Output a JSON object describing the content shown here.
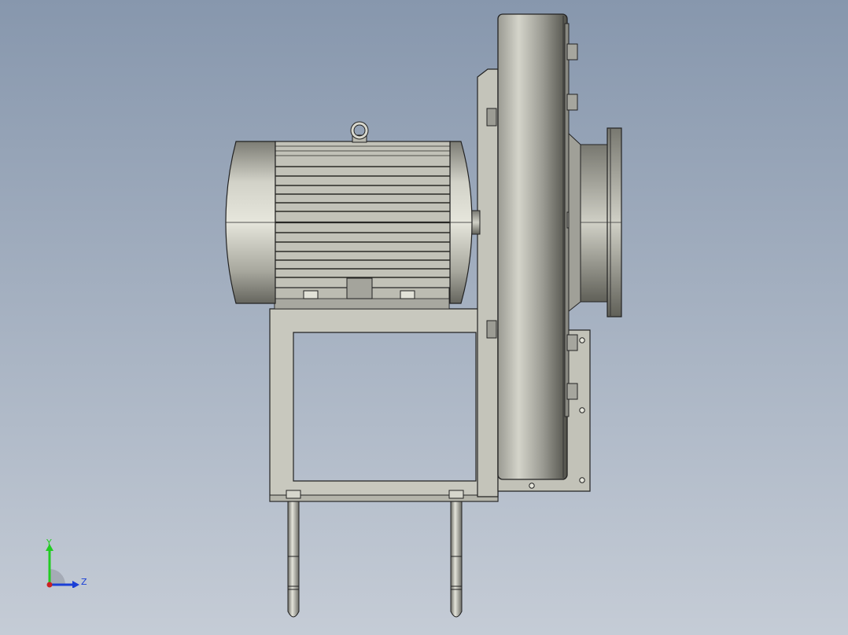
{
  "viewport": {
    "background_top": "#8797ad",
    "background_bottom": "#c5ccd6"
  },
  "model": {
    "parts": [
      "motor",
      "lifting-eye",
      "shaft",
      "motor-mount-plate",
      "base-frame",
      "vertical-support-plate",
      "fan-housing",
      "inlet-flange",
      "outlet-bracket",
      "anchor-bolts"
    ]
  },
  "triad": {
    "y_label": "Y",
    "z_label": "Z",
    "y_color": "#22cc22",
    "z_color": "#1a3fd6",
    "x_color": "#cc2222"
  }
}
